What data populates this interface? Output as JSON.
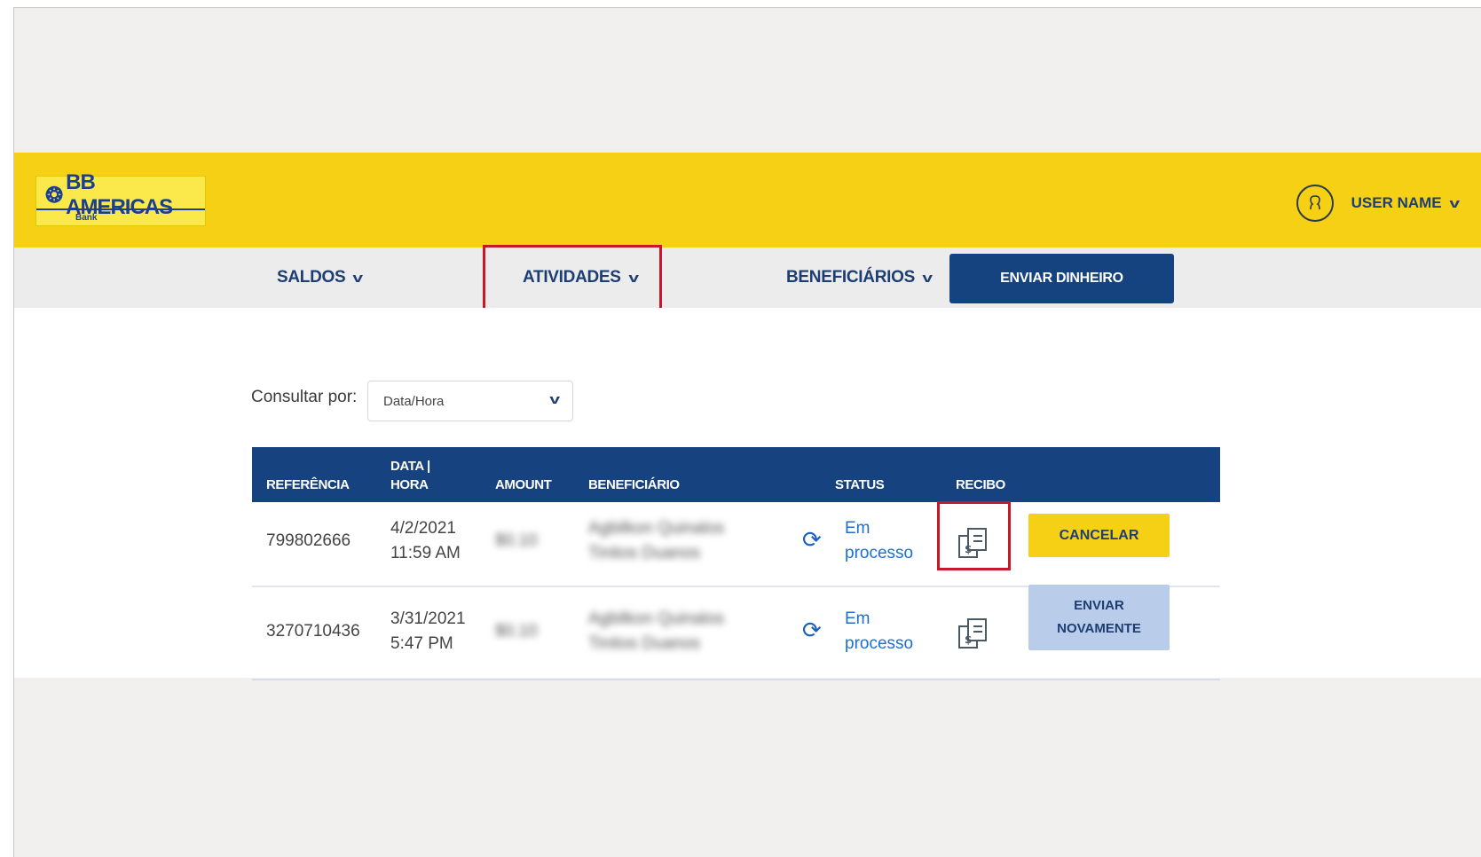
{
  "brand": {
    "logo_text": "BB AMERICAS",
    "logo_subtext": "Bank",
    "color_yellow": "#f6d014",
    "color_blue": "#16427f"
  },
  "user": {
    "name": "USER NAME",
    "icon": "user-circle-icon"
  },
  "nav": {
    "items": [
      {
        "label": "SALDOS"
      },
      {
        "label": "ATIVIDADES"
      },
      {
        "label": "BENEFICIÁRIOS"
      }
    ],
    "send_button": "ENVIAR DINHEIRO"
  },
  "filter": {
    "label": "Consultar por:",
    "selected": "Data/Hora"
  },
  "table": {
    "headers": {
      "reference": "REFERÊNCIA",
      "date_line1": "DATA |",
      "date_line2": "HORA",
      "amount": "AMOUNT",
      "beneficiary": "BENEFICIÁRIO",
      "status": "STATUS",
      "receipt": "RECIBO"
    },
    "rows": [
      {
        "reference": "799802666",
        "date": "4/2/2021",
        "time": "11:59 AM",
        "amount": "$0.10",
        "beneficiary_line1": "Agbilkon Quinalos",
        "beneficiary_line2": "Tinitos Duanos",
        "status_line1": "Em",
        "status_line2": "processo",
        "action": "CANCELAR"
      },
      {
        "reference": "3270710436",
        "date": "3/31/2021",
        "time": "5:47 PM",
        "amount": "$0.10",
        "beneficiary_line1": "Agbilkon Quinalos",
        "beneficiary_line2": "Tinitos Duanos",
        "status_line1": "Em",
        "status_line2": "processo",
        "action": "ENVIAR\nNOVAMENTE"
      }
    ]
  }
}
